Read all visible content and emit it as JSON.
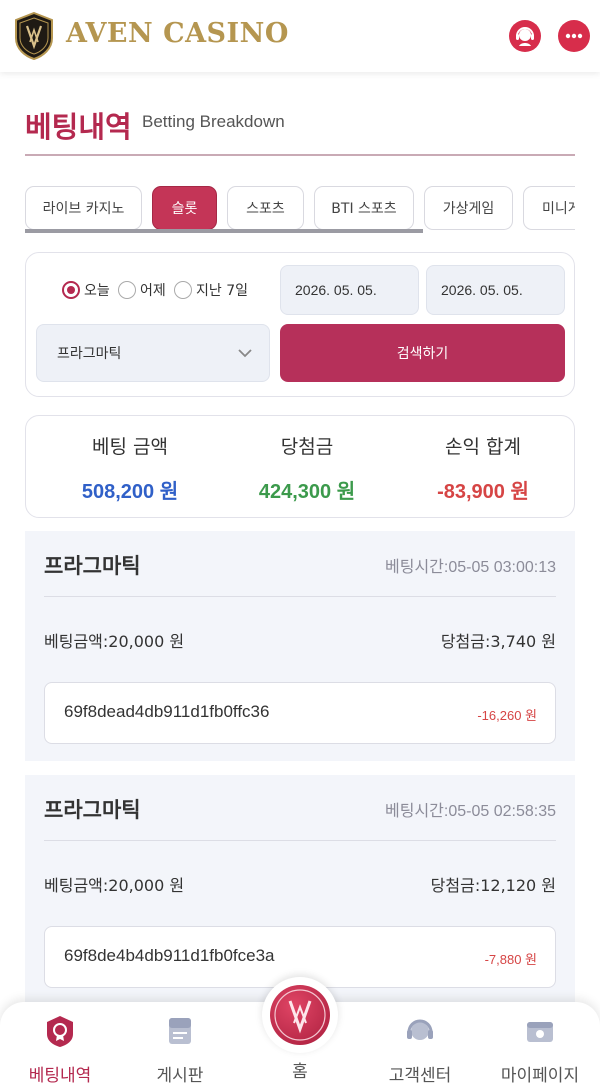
{
  "header": {
    "brand": "AVEN CASINO",
    "logo_icon": "aven-shield-logo",
    "support_icon": "support-agent-icon",
    "chat_icon": "chat-bubble-icon",
    "accent": "#d72d4b"
  },
  "page": {
    "title": "베팅내역",
    "subtitle": "Betting Breakdown",
    "accent": "#b4294f"
  },
  "tabs": [
    {
      "label": "라이브 카지노",
      "active": false
    },
    {
      "label": "슬롯",
      "active": true
    },
    {
      "label": "스포츠",
      "active": false
    },
    {
      "label": "BTI 스포츠",
      "active": false
    },
    {
      "label": "가상게임",
      "active": false
    },
    {
      "label": "미니게임",
      "active": false
    }
  ],
  "filter": {
    "radios": [
      {
        "label": "오늘",
        "selected": true
      },
      {
        "label": "어제",
        "selected": false
      },
      {
        "label": "지난 7일",
        "selected": false
      }
    ],
    "date_from": "2026. 05. 05.",
    "date_to": "2026. 05. 05.",
    "provider": "프라그마틱",
    "search_label": "검색하기"
  },
  "summary": {
    "bet": {
      "label": "베팅 금액",
      "value": "508,200 원",
      "color": "#3060c8"
    },
    "win": {
      "label": "당첨금",
      "value": "424,300 원",
      "color": "#3c9a4c"
    },
    "pl": {
      "label": "손익 합계",
      "value": "-83,900 원",
      "color": "#d64545"
    }
  },
  "bets": [
    {
      "provider": "프라그마틱",
      "time": "베팅시간:05-05 03:00:13",
      "amount": "베팅금액:20,000 원",
      "win": "당첨금:3,740 원",
      "id": "69f8dead4db911d1fb0ffc36",
      "pl": "-16,260 원"
    },
    {
      "provider": "프라그마틱",
      "time": "베팅시간:05-05 02:58:35",
      "amount": "베팅금액:20,000 원",
      "win": "당첨금:12,120 원",
      "id": "69f8de4b4db911d1fb0fce3a",
      "pl": "-7,880 원"
    }
  ],
  "nav": {
    "items": [
      {
        "label": "베팅내역",
        "icon": "betting-history-icon",
        "active": true
      },
      {
        "label": "게시판",
        "icon": "board-icon",
        "active": false
      },
      {
        "label": "홈",
        "icon": "home-logo-icon",
        "active": false
      },
      {
        "label": "고객센터",
        "icon": "headset-icon",
        "active": false
      },
      {
        "label": "마이페이지",
        "icon": "mypage-icon",
        "active": false
      }
    ]
  }
}
